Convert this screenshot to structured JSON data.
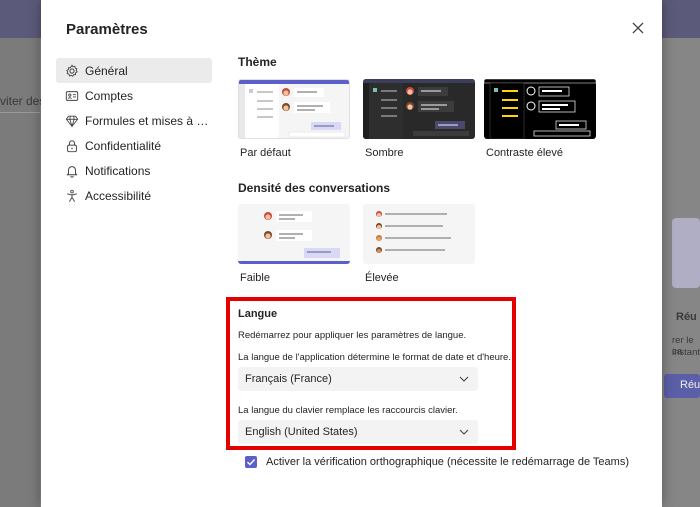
{
  "background": {
    "fragment_left": "viter des",
    "fragment_right_title": "Réu",
    "fragment_right_text1": "rer le ca",
    "fragment_right_text2": "instant",
    "fragment_right_button": "Réu"
  },
  "dialog": {
    "title": "Paramètres",
    "close_icon": "close-icon"
  },
  "nav": {
    "items": [
      {
        "label": "Général",
        "icon": "gear-icon",
        "active": true
      },
      {
        "label": "Comptes",
        "icon": "id-card-icon"
      },
      {
        "label": "Formules et mises à nive...",
        "icon": "diamond-icon"
      },
      {
        "label": "Confidentialité",
        "icon": "lock-icon"
      },
      {
        "label": "Notifications",
        "icon": "bell-icon"
      },
      {
        "label": "Accessibilité",
        "icon": "accessibility-icon"
      }
    ]
  },
  "theme": {
    "title": "Thème",
    "options": [
      {
        "label": "Par défaut",
        "selected": true
      },
      {
        "label": "Sombre"
      },
      {
        "label": "Contraste élevé"
      }
    ]
  },
  "density": {
    "title": "Densité des conversations",
    "options": [
      {
        "label": "Faible",
        "selected": true
      },
      {
        "label": "Élevée"
      }
    ]
  },
  "language": {
    "title": "Langue",
    "restart_note": "Redémarrez pour appliquer les paramètres de langue.",
    "app_lang_desc": "La langue de l'application détermine le format de date et d'heure.",
    "app_lang_value": "Français (France)",
    "keyboard_lang_desc": "La langue du clavier remplace les raccourcis clavier.",
    "keyboard_lang_value": "English (United States)"
  },
  "spellcheck": {
    "label": "Activer la vérification orthographique (nécessite le redémarrage de Teams)",
    "checked": true
  },
  "colors": {
    "accent": "#5b5fc7",
    "highlight_box": "#e50000"
  }
}
